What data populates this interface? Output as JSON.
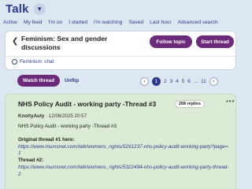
{
  "header": {
    "title": "Talk",
    "dropdown_icon": "chevron-down-icon"
  },
  "nav": {
    "items": [
      "Active",
      "My feed",
      "I'm on",
      "I started",
      "I'm watching",
      "Saved",
      "Last hour",
      "Advanced search"
    ]
  },
  "topic": {
    "back_icon": "chevron-left-icon",
    "title": "Feminism: Sex and gender discussions",
    "follow_label": "Follow topic",
    "start_label": "Start thread",
    "chat_link": "Feminism: chat",
    "chat_icon": "chat-icon"
  },
  "toolbar": {
    "watch_label": "Watch thread",
    "unflip_label": "Unflip"
  },
  "pager": {
    "prev_icon": "chevron-left-icon",
    "next_icon": "chevron-right-icon",
    "current": "1",
    "pages": [
      "2",
      "3",
      "4",
      "5",
      "6"
    ],
    "ellipsis": "...",
    "last": "11"
  },
  "post": {
    "title": "NHS Policy Audit - working party -Thread #3",
    "replies": "268 replies",
    "more_icon": "more-horizontal-icon",
    "author": "KnottyAuty",
    "separator": "·",
    "date": "12/06/2025 20:57",
    "subtitle": "NHS Policy Audit - working party -Thread #3",
    "original_label": "Original thread #1 here:",
    "original_link": "https://www.mumsnet.com/talk/womens_rights/5291237-nhs-policy-audit-working-party?page=1",
    "thread2_label": "Thread #2:",
    "thread2_link": "https://www.mumsnet.com/talk/womens_rights/5322494-nhs-policy-audit-working-party-thread-2"
  },
  "colors": {
    "accent": "#6b2a7a",
    "link": "#2d3b8c",
    "page_bg": "#dde7f1",
    "post_bg": "#dcebd6"
  }
}
